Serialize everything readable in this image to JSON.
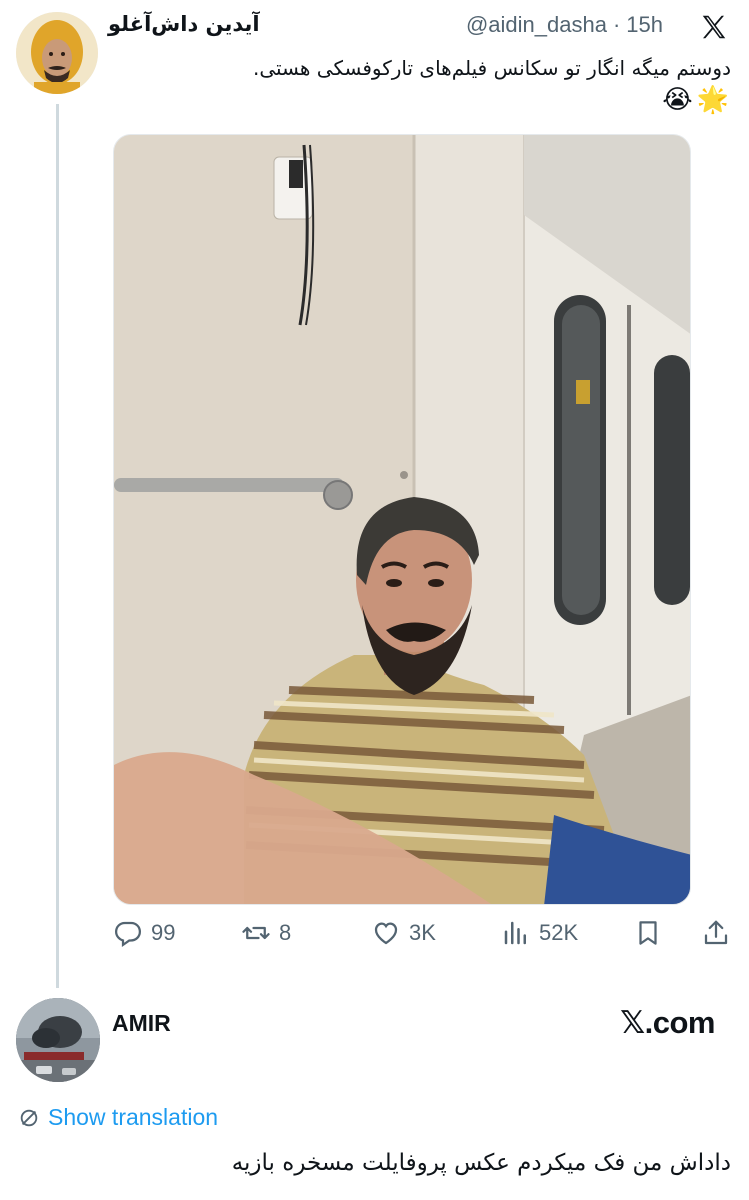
{
  "tweet": {
    "display_name": "آیدین داش‌آغلو",
    "handle": "@aidin_dasha",
    "separator": "·",
    "time": "15h",
    "text": "دوستم میگه انگار تو سکانس فیلم‌های تارکوفسکی هستی.",
    "emojis": [
      "😭",
      "🌟"
    ],
    "stats": {
      "replies": "99",
      "reposts": "8",
      "likes": "3K",
      "views": "52K"
    },
    "icons": [
      "x-logo-icon",
      "reply-icon",
      "repost-icon",
      "like-icon",
      "views-icon",
      "bookmark-icon",
      "share-icon"
    ]
  },
  "reply": {
    "author": "AMIR",
    "brand": "𝕏.com",
    "show_translation": "Show translation",
    "text": "داداش من فک میکردم عکس پروفایلت مسخره بازیه"
  },
  "colors": {
    "text_primary": "#0f1419",
    "text_secondary": "#536471",
    "link": "#1d9bf0",
    "thread_line": "#cfd9de"
  }
}
